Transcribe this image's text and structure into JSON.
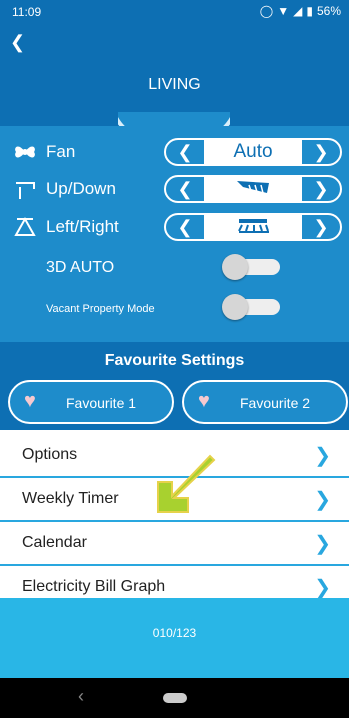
{
  "status": {
    "time": "11:09",
    "battery": "56%"
  },
  "header": {
    "title": "LIVING"
  },
  "controls": {
    "fan": {
      "label": "Fan",
      "value": "Auto"
    },
    "updown": {
      "label": "Up/Down"
    },
    "leftright": {
      "label": "Left/Right"
    },
    "auto3d": {
      "label": "3D AUTO"
    },
    "vacant": {
      "label": "Vacant Property Mode"
    }
  },
  "favourites": {
    "title": "Favourite Settings",
    "items": [
      {
        "label": "Favourite 1"
      },
      {
        "label": "Favourite 2"
      }
    ]
  },
  "menu": [
    {
      "label": "Options"
    },
    {
      "label": "Weekly Timer"
    },
    {
      "label": "Calendar"
    },
    {
      "label": "Electricity Bill Graph"
    }
  ],
  "footer": {
    "page": "010/123"
  },
  "colors": {
    "primary": "#0d6fb3",
    "panel": "#1e8ccb",
    "accent": "#29a7df",
    "pointer": "#a8d12f"
  }
}
